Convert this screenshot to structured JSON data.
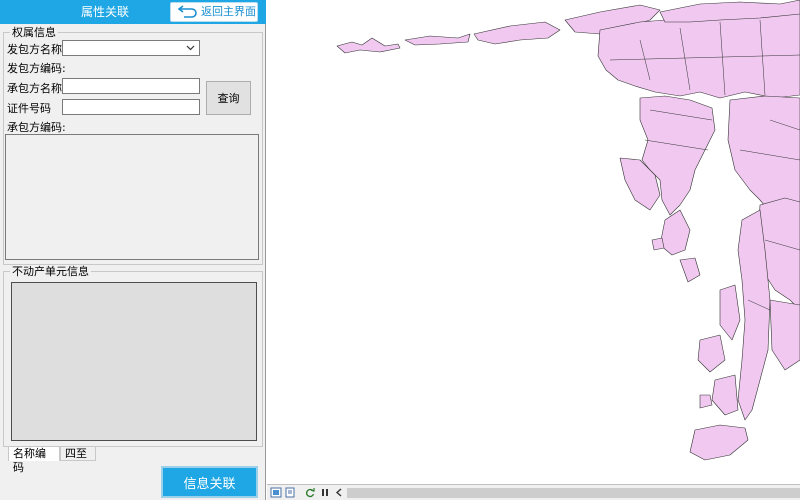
{
  "window": {
    "title": "属性关联",
    "back_label": "返回主界面"
  },
  "owner_section": {
    "legend": "权属信息",
    "issuer_name_label": "发包方名称",
    "issuer_name_value": "",
    "issuer_code_label": "发包方编码:",
    "contractor_name_label": "承包方名称",
    "contractor_name_value": "",
    "cert_no_label": "证件号码",
    "cert_no_value": "",
    "query_label": "查询",
    "contractor_code_label": "承包方编码:"
  },
  "realty_section": {
    "legend": "不动产单元信息",
    "tabs": [
      "名称编码",
      "四至"
    ]
  },
  "actions": {
    "link_label": "信息关联"
  },
  "colors": {
    "accent": "#1ea7e4",
    "parcel_fill": "#f0c8f0",
    "parcel_stroke": "#333333"
  },
  "icons": {
    "back": "return-arrow-icon",
    "dropdown": "chevron-down-icon",
    "status": [
      "layout-view-icon",
      "page-view-icon",
      "refresh-icon",
      "pause-icon",
      "scroll-left-icon"
    ]
  }
}
